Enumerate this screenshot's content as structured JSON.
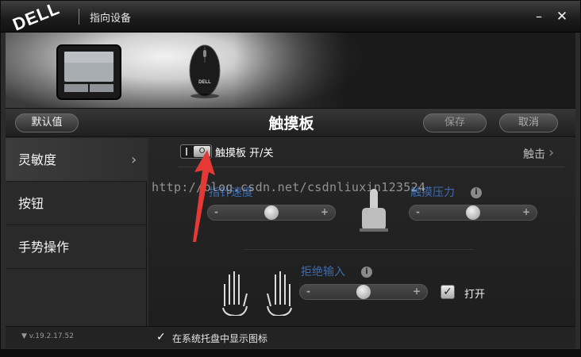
{
  "window": {
    "logo": "DELL",
    "title": "指向设备",
    "minimize_glyph": "–",
    "close_glyph": "✕"
  },
  "banner": {
    "devices": [
      "touchpad-device-icon",
      "mouse-device-icon"
    ]
  },
  "header": {
    "default_label": "默认值",
    "page_title": "触摸板",
    "save_label": "保存",
    "cancel_label": "取消"
  },
  "sidebar": {
    "items": [
      {
        "label": "灵敏度",
        "chevron": "›"
      },
      {
        "label": "按钮"
      },
      {
        "label": "手势操作"
      }
    ]
  },
  "main": {
    "toggle": {
      "off_glyph": "I",
      "on_glyph": "O",
      "label": "触摸板 开/关"
    },
    "tap_link": "触击",
    "tap_chevron": "›",
    "pointer_speed_label": "指针速度",
    "tap_pressure_label": "触摸压力",
    "reject_input_label": "拒绝输入",
    "reject_input_open_label": "打开",
    "info_glyph": "i",
    "slider_minus": "-",
    "slider_plus": "+",
    "pointer_speed_value": 0.5,
    "tap_pressure_value": 0.5,
    "reject_input_value": 0.5,
    "reject_input_checked": true,
    "check_glyph": "✓"
  },
  "footer": {
    "version": "▼ v.19.2.17.52",
    "tray_label": "在系统托盘中显示图标",
    "tray_checked": true
  },
  "overlay": {
    "watermark": "http://blog.csdn.net/csdnliuxin123524"
  },
  "colors": {
    "accent_label": "#3c6bb0",
    "arrow": "#e53935"
  }
}
